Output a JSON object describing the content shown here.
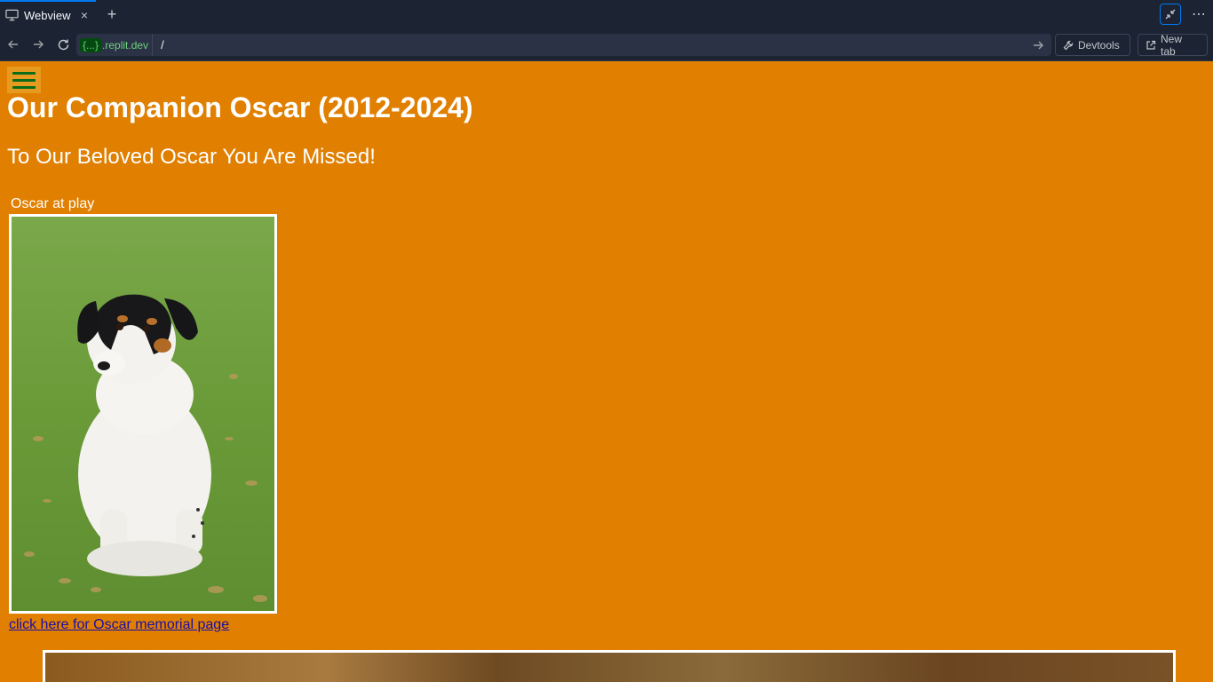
{
  "browser": {
    "tab": {
      "label": "Webview",
      "close_glyph": "×"
    },
    "new_tab_glyph": "+",
    "more_glyph": "⋯",
    "url": {
      "badge": "{...}",
      "domain": ".replit.dev",
      "path": "/"
    },
    "devtools_label": "Devtools",
    "newtab_label": "New tab"
  },
  "page": {
    "title": "Our Companion Oscar (2012-2024)",
    "subtitle": "To Our Beloved Oscar You Are Missed!",
    "photo_caption": "Oscar at play",
    "memorial_link": "click here for Oscar memorial page"
  },
  "colors": {
    "page_background": "#e07f00",
    "chrome_background": "#1c2333",
    "accent": "#0079f2",
    "hamburger_bars": "#0a6b18",
    "link": "#1a0dab"
  }
}
